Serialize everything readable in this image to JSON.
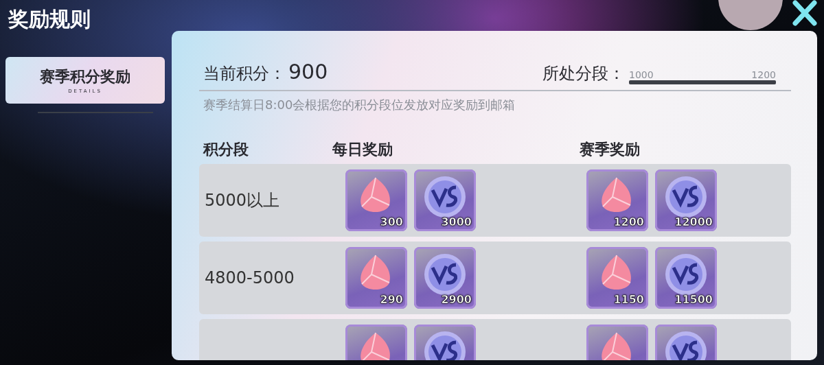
{
  "title": "奖励规则",
  "tabs": [
    {
      "label": "赛季积分奖励",
      "sublabel": "DETAILS",
      "selected": true
    }
  ],
  "score": {
    "label": "当前积分：",
    "value": "900"
  },
  "tier": {
    "label": "所处分段：",
    "min": "1000",
    "max": "1200",
    "level": 1
  },
  "note": "赛季结算日8:00会根据您的积分段位发放对应奖励到邮箱",
  "columns": [
    "积分段",
    "每日奖励",
    "赛季奖励"
  ],
  "rows": [
    {
      "range": "5000以上",
      "daily": [
        {
          "kind": "gem",
          "amount": "300"
        },
        {
          "kind": "coin",
          "amount": "3000"
        }
      ],
      "season": [
        {
          "kind": "gem",
          "amount": "1200"
        },
        {
          "kind": "coin",
          "amount": "12000"
        }
      ]
    },
    {
      "range": "4800-5000",
      "daily": [
        {
          "kind": "gem",
          "amount": "290"
        },
        {
          "kind": "coin",
          "amount": "2900"
        }
      ],
      "season": [
        {
          "kind": "gem",
          "amount": "1150"
        },
        {
          "kind": "coin",
          "amount": "11500"
        }
      ]
    },
    {
      "daily": [
        {
          "kind": "gem"
        },
        {
          "kind": "coin"
        }
      ],
      "season": [
        {
          "kind": "gem"
        },
        {
          "kind": "coin"
        }
      ]
    }
  ]
}
